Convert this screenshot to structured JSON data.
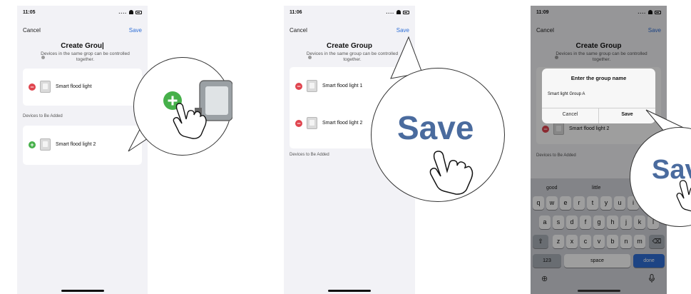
{
  "panels": [
    {
      "time": "11:05",
      "signal": "....",
      "cancel_label": "Cancel",
      "save_label": "Save",
      "title": "Create Grou|",
      "hint": "Devices in the same grop can be controlled together.",
      "group_devices": [
        "Smart flood light"
      ],
      "section_label": "Devices to Be Added",
      "devices_to_add": [
        "Smart flood light 2"
      ]
    },
    {
      "time": "11:06",
      "signal": "....",
      "cancel_label": "Cancel",
      "save_label": "Save",
      "title": "Create Group",
      "hint": "Devices in the same group can be controlled together.",
      "group_devices": [
        "Smart flood light 1",
        "Smart flood light 2"
      ],
      "section_label": "Devices to Be Added",
      "zoom_text": "Save"
    },
    {
      "time": "11:09",
      "signal": "....",
      "cancel_label": "Cancel",
      "save_label": "Save",
      "title": "Create Group",
      "hint": "Devices in the same group can be controlled together.",
      "background_device": "Smart flood light 2",
      "section_label": "Devices to Be Added",
      "dialog": {
        "title": "Enter the group name",
        "input_value": "Smart light Group A",
        "cancel_label": "Cancel",
        "save_label": "Save"
      },
      "keyboard": {
        "suggestions": [
          "good",
          "little"
        ],
        "row1": [
          "q",
          "w",
          "e",
          "r",
          "t",
          "y",
          "u",
          "i",
          "o"
        ],
        "row2": [
          "a",
          "s",
          "d",
          "f",
          "g",
          "h",
          "j",
          "k",
          "l"
        ],
        "row3": [
          "z",
          "x",
          "c",
          "v",
          "b",
          "n",
          "m"
        ],
        "numbers_label": "123",
        "space_label": "space",
        "done_label": "done"
      },
      "zoom_text": "Sav"
    }
  ],
  "icons": [
    "remove-device-icon",
    "add-device-icon",
    "hand-pointer-icon",
    "globe-icon",
    "microphone-icon",
    "shift-icon",
    "backspace-icon",
    "wifi-icon",
    "battery-icon"
  ],
  "colors": {
    "accent": "#2f6fd6",
    "remove": "#e0454f",
    "add": "#46b04a",
    "zoom_text": "#4a6b9e"
  }
}
